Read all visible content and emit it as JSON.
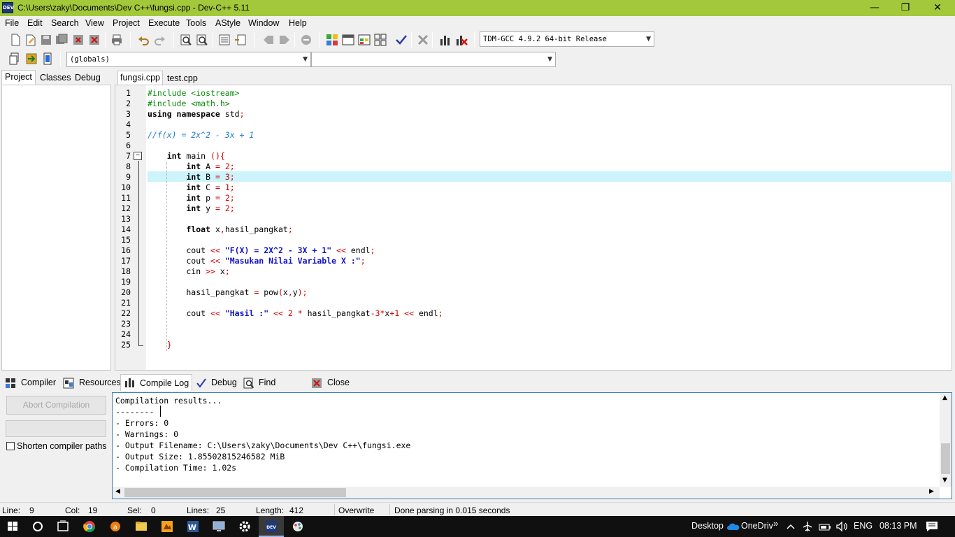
{
  "window": {
    "title": "C:\\Users\\zaky\\Documents\\Dev C++\\fungsi.cpp - Dev-C++ 5.11",
    "app_icon_text": "DEV",
    "minimize": "—",
    "maximize": "❐",
    "close": "✕"
  },
  "menu": [
    "File",
    "Edit",
    "Search",
    "View",
    "Project",
    "Execute",
    "Tools",
    "AStyle",
    "Window",
    "Help"
  ],
  "toolbar": {
    "compiler_select": "TDM-GCC 4.9.2 64-bit Release",
    "scope_select": "(globals)",
    "member_select": ""
  },
  "left_tabs": [
    "Project",
    "Classes",
    "Debug"
  ],
  "editor_tabs": [
    "fungsi.cpp",
    "test.cpp"
  ],
  "code": {
    "line_numbers": [
      "1",
      "2",
      "3",
      "4",
      "5",
      "6",
      "7",
      "8",
      "9",
      "10",
      "11",
      "12",
      "13",
      "14",
      "15",
      "16",
      "17",
      "18",
      "19",
      "20",
      "21",
      "22",
      "23",
      "24",
      "25"
    ],
    "fold_marker": "−",
    "lines": [
      [
        {
          "t": "#include <iostream>",
          "c": "pp"
        }
      ],
      [
        {
          "t": "#include <math.h>",
          "c": "pp"
        }
      ],
      [
        {
          "t": "using namespace",
          "c": "kw"
        },
        {
          "t": " std"
        },
        {
          "t": ";",
          "c": "sym"
        }
      ],
      [],
      [
        {
          "t": "//f(x) = 2x^2 - 3x + 1",
          "c": "cm"
        }
      ],
      [],
      [
        {
          "t": "    "
        },
        {
          "t": "int",
          "c": "kw"
        },
        {
          "t": " main "
        },
        {
          "t": "(){",
          "c": "sym"
        }
      ],
      [
        {
          "t": "        "
        },
        {
          "t": "int",
          "c": "kw"
        },
        {
          "t": " A "
        },
        {
          "t": "=",
          "c": "sym"
        },
        {
          "t": " "
        },
        {
          "t": "2",
          "c": "num"
        },
        {
          "t": ";",
          "c": "sym"
        }
      ],
      [
        {
          "t": "        "
        },
        {
          "t": "int",
          "c": "kw"
        },
        {
          "t": " B "
        },
        {
          "t": "=",
          "c": "sym"
        },
        {
          "t": " "
        },
        {
          "t": "3",
          "c": "num"
        },
        {
          "t": ";",
          "c": "sym"
        }
      ],
      [
        {
          "t": "        "
        },
        {
          "t": "int",
          "c": "kw"
        },
        {
          "t": " C "
        },
        {
          "t": "=",
          "c": "sym"
        },
        {
          "t": " "
        },
        {
          "t": "1",
          "c": "num"
        },
        {
          "t": ";",
          "c": "sym"
        }
      ],
      [
        {
          "t": "        "
        },
        {
          "t": "int",
          "c": "kw"
        },
        {
          "t": " p "
        },
        {
          "t": "=",
          "c": "sym"
        },
        {
          "t": " "
        },
        {
          "t": "2",
          "c": "num"
        },
        {
          "t": ";",
          "c": "sym"
        }
      ],
      [
        {
          "t": "        "
        },
        {
          "t": "int",
          "c": "kw"
        },
        {
          "t": " y "
        },
        {
          "t": "=",
          "c": "sym"
        },
        {
          "t": " "
        },
        {
          "t": "2",
          "c": "num"
        },
        {
          "t": ";",
          "c": "sym"
        }
      ],
      [],
      [
        {
          "t": "        "
        },
        {
          "t": "float",
          "c": "kw"
        },
        {
          "t": " x"
        },
        {
          "t": ",",
          "c": "sym"
        },
        {
          "t": "hasil_pangkat"
        },
        {
          "t": ";",
          "c": "sym"
        }
      ],
      [],
      [
        {
          "t": "        cout "
        },
        {
          "t": "<<",
          "c": "sym"
        },
        {
          "t": " "
        },
        {
          "t": "\"F(X) = 2X^2 - 3X + 1\"",
          "c": "str"
        },
        {
          "t": " "
        },
        {
          "t": "<<",
          "c": "sym"
        },
        {
          "t": " endl"
        },
        {
          "t": ";",
          "c": "sym"
        }
      ],
      [
        {
          "t": "        cout "
        },
        {
          "t": "<<",
          "c": "sym"
        },
        {
          "t": " "
        },
        {
          "t": "\"Masukan Nilai Variable X :\"",
          "c": "str"
        },
        {
          "t": ";",
          "c": "sym"
        }
      ],
      [
        {
          "t": "        cin "
        },
        {
          "t": ">>",
          "c": "sym"
        },
        {
          "t": " x"
        },
        {
          "t": ";",
          "c": "sym"
        }
      ],
      [],
      [
        {
          "t": "        hasil_pangkat "
        },
        {
          "t": "=",
          "c": "sym"
        },
        {
          "t": " pow"
        },
        {
          "t": "(",
          "c": "sym"
        },
        {
          "t": "x"
        },
        {
          "t": ",",
          "c": "sym"
        },
        {
          "t": "y"
        },
        {
          "t": ");",
          "c": "sym"
        }
      ],
      [],
      [
        {
          "t": "        cout "
        },
        {
          "t": "<<",
          "c": "sym"
        },
        {
          "t": " "
        },
        {
          "t": "\"Hasil :\"",
          "c": "str"
        },
        {
          "t": " "
        },
        {
          "t": "<<",
          "c": "sym"
        },
        {
          "t": " "
        },
        {
          "t": "2",
          "c": "num"
        },
        {
          "t": " "
        },
        {
          "t": "*",
          "c": "sym"
        },
        {
          "t": " hasil_pangkat"
        },
        {
          "t": "-",
          "c": "sym"
        },
        {
          "t": "3",
          "c": "num"
        },
        {
          "t": "*",
          "c": "sym"
        },
        {
          "t": "x"
        },
        {
          "t": "+",
          "c": "sym"
        },
        {
          "t": "1",
          "c": "num"
        },
        {
          "t": " "
        },
        {
          "t": "<<",
          "c": "sym"
        },
        {
          "t": " endl"
        },
        {
          "t": ";",
          "c": "sym"
        }
      ],
      [],
      [],
      [
        {
          "t": "    "
        },
        {
          "t": "}",
          "c": "sym"
        }
      ]
    ]
  },
  "bottom_tabs": [
    "Compiler",
    "Resources",
    "Compile Log",
    "Debug",
    "Find Results",
    "Close"
  ],
  "compile": {
    "abort_button": "Abort Compilation",
    "shorten_label": "Shorten compiler paths",
    "log": [
      "Compilation results...",
      "--------",
      "- Errors: 0",
      "- Warnings: 0",
      "- Output Filename: C:\\Users\\zaky\\Documents\\Dev C++\\fungsi.exe",
      "- Output Size: 1.85502815246582 MiB",
      "- Compilation Time: 1.02s"
    ]
  },
  "status": {
    "line_label": "Line:",
    "line_value": "9",
    "col_label": "Col:",
    "col_value": "19",
    "sel_label": "Sel:",
    "sel_value": "0",
    "lines_label": "Lines:",
    "lines_value": "25",
    "length_label": "Length:",
    "length_value": "412",
    "mode": "Overwrite",
    "message": "Done parsing in 0.015 seconds"
  },
  "taskbar": {
    "desktop": "Desktop",
    "onedrive": "OneDriv",
    "more": "»",
    "language": "ENG",
    "time": "08:13 PM"
  }
}
